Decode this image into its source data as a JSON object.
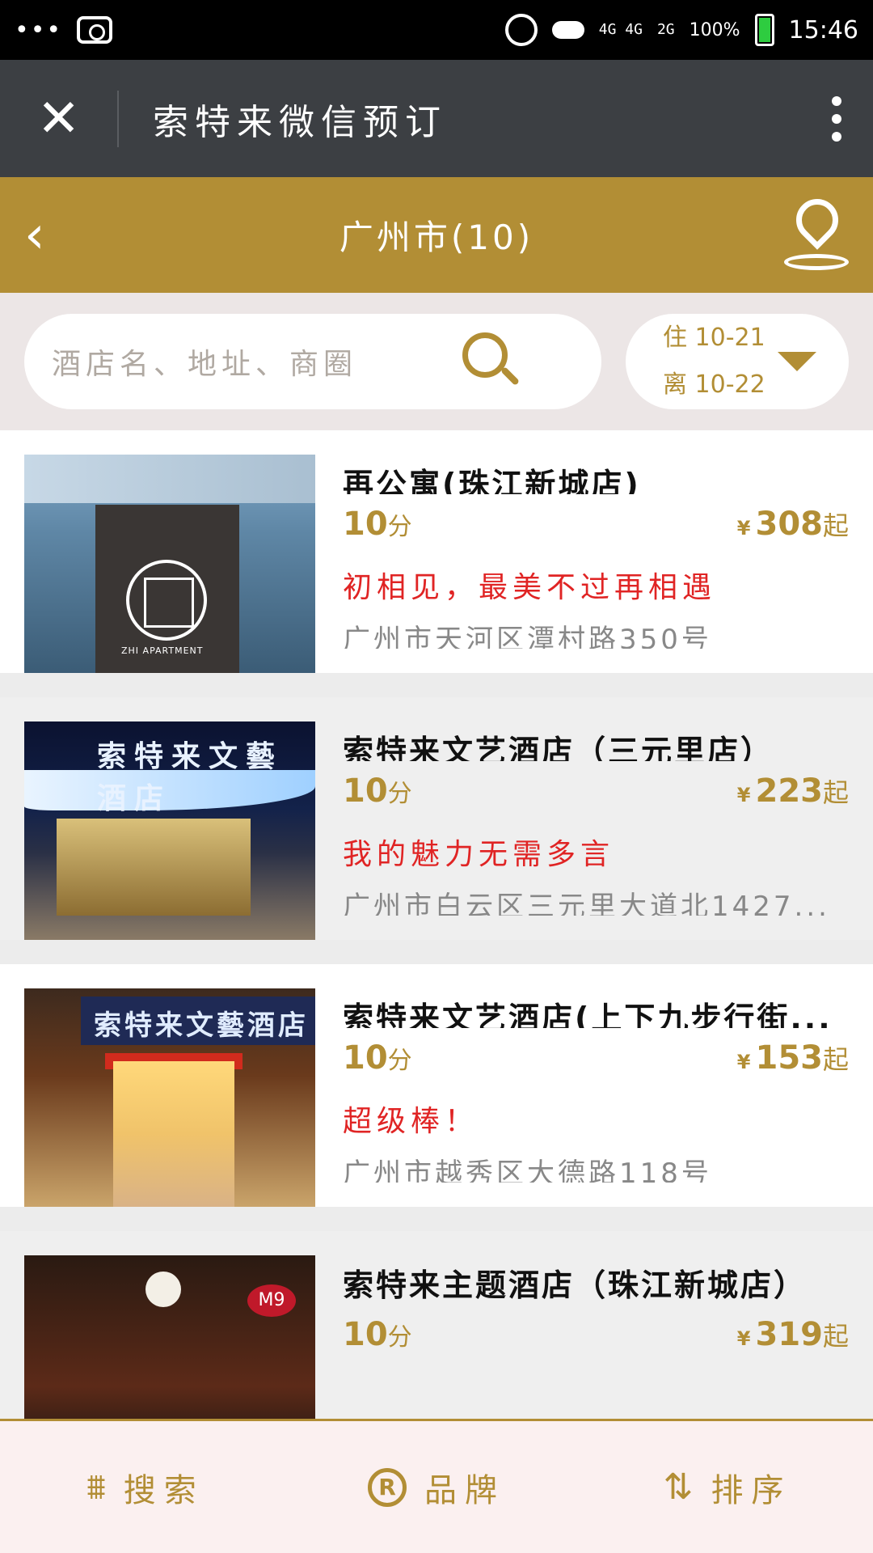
{
  "status_bar": {
    "signal": "4G 4G",
    "sub_signal": "2G",
    "battery": "100%",
    "time": "15:46"
  },
  "titlebar": {
    "title": "索特来微信预订"
  },
  "navbar": {
    "title": "广州市(10)"
  },
  "search": {
    "placeholder": "酒店名、地址、商圈",
    "checkin": "住 10-21",
    "checkout": "离 10-22"
  },
  "hotels": [
    {
      "name": "再公寓(珠江新城店)",
      "score": "10",
      "score_unit": "分",
      "currency": "¥",
      "price": "308",
      "price_unit": "起",
      "slogan": "初相见，最美不过再相遇",
      "address": "广州市天河区潭村路350号",
      "thumb_text": "ZHI APARTMENT"
    },
    {
      "name": "索特来文艺酒店（三元里店）",
      "score": "10",
      "score_unit": "分",
      "currency": "¥",
      "price": "223",
      "price_unit": "起",
      "slogan": "我的魅力无需多言",
      "address": "广州市白云区三元里大道北1427...",
      "thumb_text": "索特来文藝酒店"
    },
    {
      "name": "索特来文艺酒店(上下九步行街...",
      "score": "10",
      "score_unit": "分",
      "currency": "¥",
      "price": "153",
      "price_unit": "起",
      "slogan": "超级棒！",
      "address": "广州市越秀区大德路118号",
      "thumb_text": "索特来文藝酒店"
    },
    {
      "name": "索特来主题酒店（珠江新城店）",
      "score": "10",
      "score_unit": "分",
      "currency": "¥",
      "price": "319",
      "price_unit": "起",
      "thumb_text": "M9"
    }
  ],
  "tabbar": {
    "search": "搜索",
    "brand": "品牌",
    "brand_icon": "R",
    "sort": "排序"
  },
  "colors": {
    "gold": "#b28e35",
    "red": "#e02424",
    "dark": "#3c3f43"
  }
}
